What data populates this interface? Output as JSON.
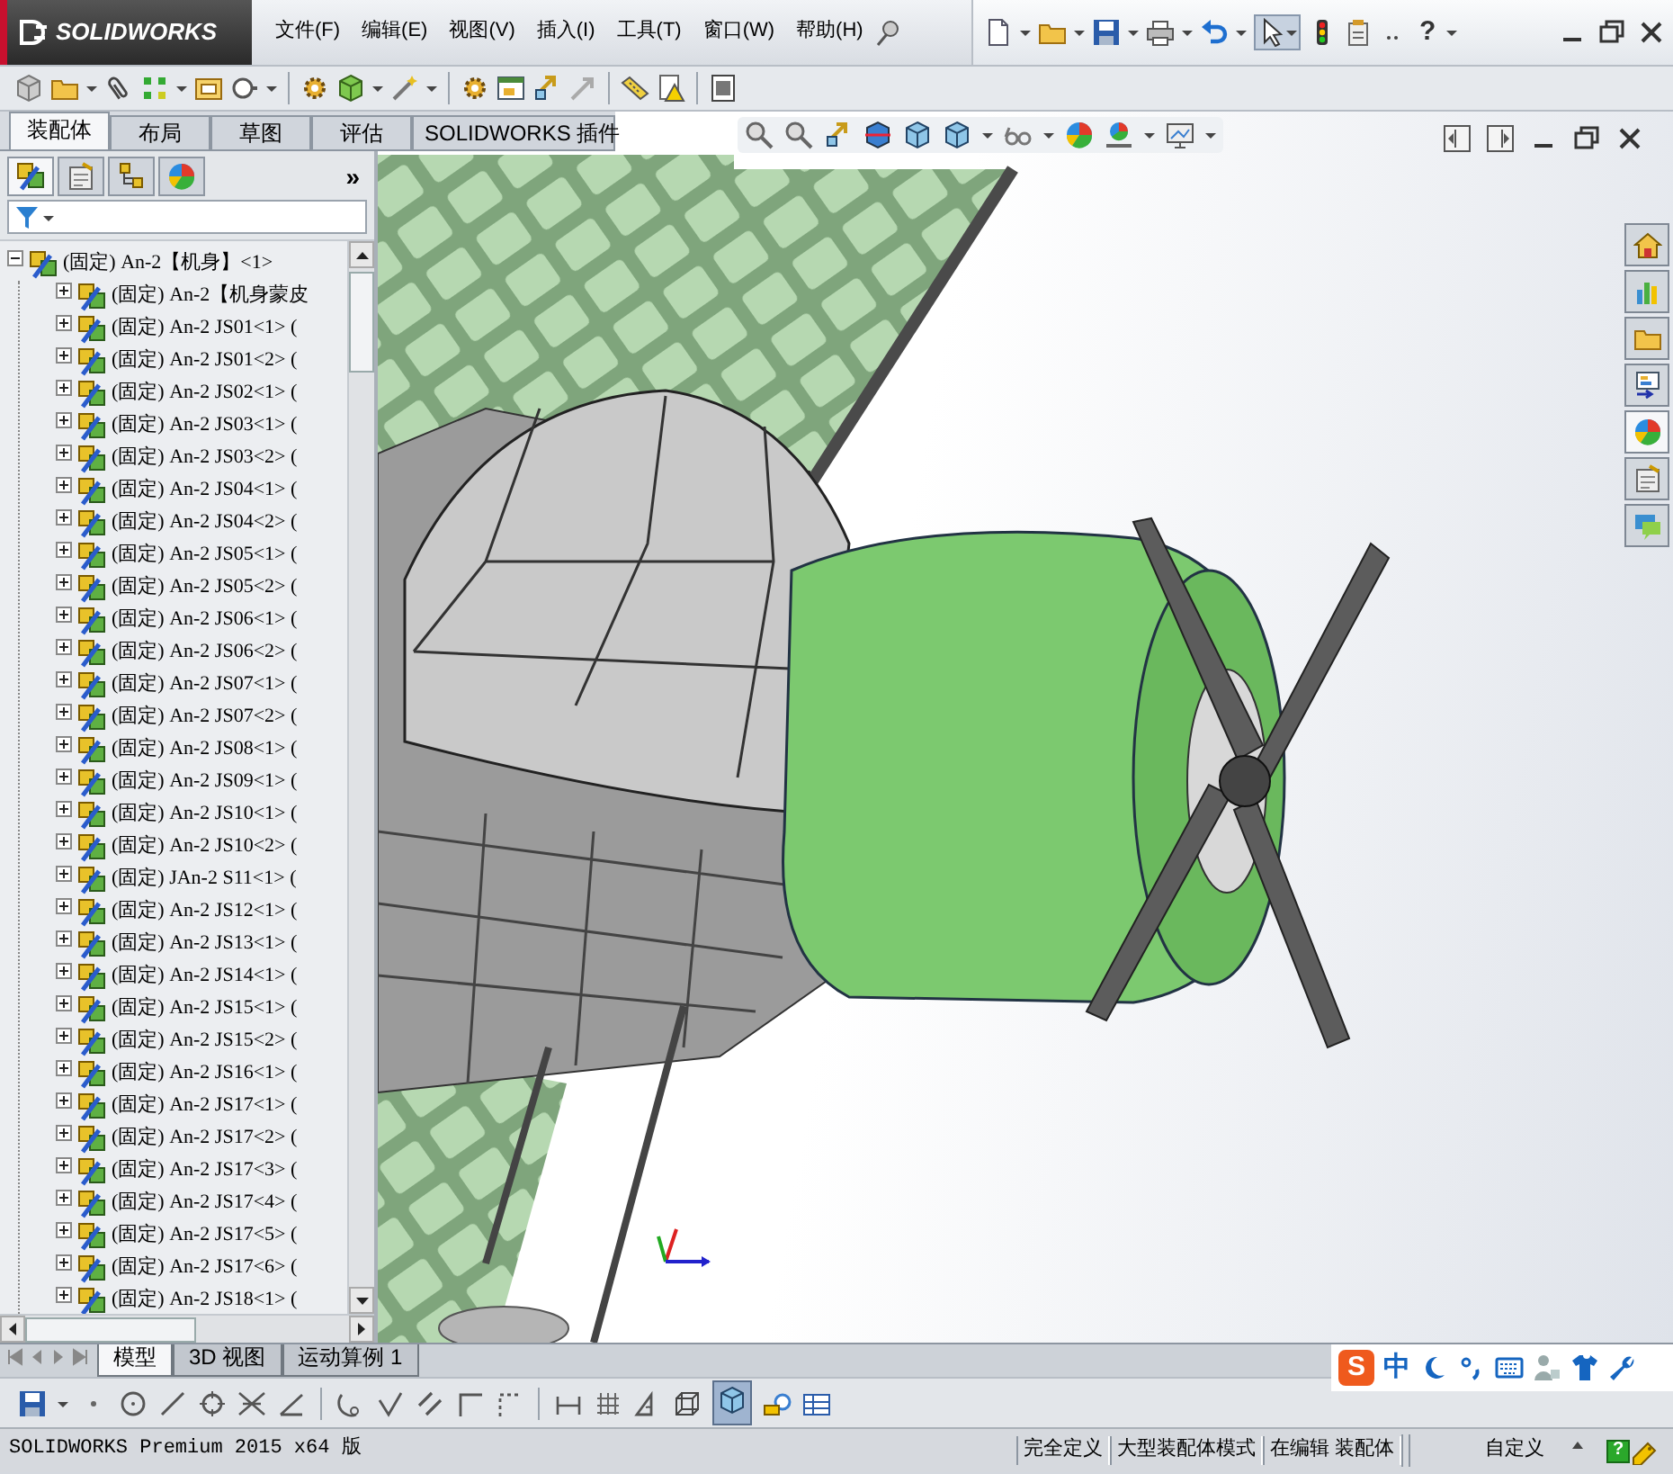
{
  "title_bar": {
    "logo": "SOLIDWORKS",
    "menus": [
      "文件(F)",
      "编辑(E)",
      "视图(V)",
      "插入(I)",
      "工具(T)",
      "窗口(W)",
      "帮助(H)"
    ],
    "help": "?"
  },
  "command_tabs": [
    {
      "label": "装配体",
      "selected": true
    },
    {
      "label": "布局",
      "selected": false
    },
    {
      "label": "草图",
      "selected": false
    },
    {
      "label": "评估",
      "selected": false
    },
    {
      "label": "SOLIDWORKS 插件",
      "selected": false
    }
  ],
  "panel_tabs": [
    {
      "kind": "feature",
      "selected": true
    },
    {
      "kind": "property",
      "selected": false
    },
    {
      "kind": "config",
      "selected": false
    },
    {
      "kind": "appearance",
      "selected": false
    }
  ],
  "panel_more": "»",
  "tree": {
    "label": "(固定) An-2【机身】<1>",
    "expanded": true,
    "children": [
      {
        "label": "(固定) An-2【机身蒙皮",
        "expanded": false
      },
      {
        "label": "(固定) An-2 JS01<1> (",
        "expanded": false
      },
      {
        "label": "(固定) An-2 JS01<2> (",
        "expanded": false
      },
      {
        "label": "(固定) An-2 JS02<1> (",
        "expanded": false
      },
      {
        "label": "(固定) An-2 JS03<1> (",
        "expanded": false
      },
      {
        "label": "(固定) An-2 JS03<2> (",
        "expanded": false
      },
      {
        "label": "(固定) An-2 JS04<1> (",
        "expanded": false
      },
      {
        "label": "(固定) An-2 JS04<2> (",
        "expanded": false
      },
      {
        "label": "(固定) An-2 JS05<1> (",
        "expanded": false
      },
      {
        "label": "(固定) An-2 JS05<2> (",
        "expanded": false
      },
      {
        "label": "(固定) An-2 JS06<1> (",
        "expanded": false
      },
      {
        "label": "(固定) An-2 JS06<2> (",
        "expanded": false
      },
      {
        "label": "(固定) An-2 JS07<1> (",
        "expanded": false
      },
      {
        "label": "(固定) An-2 JS07<2> (",
        "expanded": false
      },
      {
        "label": "(固定) An-2 JS08<1> (",
        "expanded": false
      },
      {
        "label": "(固定) An-2 JS09<1> (",
        "expanded": false
      },
      {
        "label": "(固定) An-2 JS10<1> (",
        "expanded": false
      },
      {
        "label": "(固定) An-2 JS10<2> (",
        "expanded": false
      },
      {
        "label": "(固定) JAn-2 S11<1> (",
        "expanded": false
      },
      {
        "label": "(固定) An-2 JS12<1> (",
        "expanded": false
      },
      {
        "label": "(固定) An-2 JS13<1> (",
        "expanded": false
      },
      {
        "label": "(固定) An-2 JS14<1> (",
        "expanded": false
      },
      {
        "label": "(固定) An-2 JS15<1> (",
        "expanded": false
      },
      {
        "label": "(固定) An-2 JS15<2> (",
        "expanded": false
      },
      {
        "label": "(固定) An-2 JS16<1> (",
        "expanded": false
      },
      {
        "label": "(固定) An-2 JS17<1> (",
        "expanded": false
      },
      {
        "label": "(固定) An-2 JS17<2> (",
        "expanded": false
      },
      {
        "label": "(固定) An-2 JS17<3> (",
        "expanded": false
      },
      {
        "label": "(固定) An-2 JS17<4> (",
        "expanded": false
      },
      {
        "label": "(固定) An-2 JS17<5> (",
        "expanded": false
      },
      {
        "label": "(固定) An-2 JS17<6> (",
        "expanded": false
      },
      {
        "label": "(固定) An-2 JS18<1> (",
        "expanded": false
      }
    ]
  },
  "bottom_tabs": [
    {
      "label": "模型",
      "selected": true
    },
    {
      "label": "3D 视图",
      "selected": false
    },
    {
      "label": "运动算例 1",
      "selected": false
    }
  ],
  "ime": {
    "logo": "S",
    "mode": "中"
  },
  "status_bar": {
    "product": "SOLIDWORKS Premium 2015 x64 版",
    "fields": [
      "完全定义",
      "大型装配体模式",
      "在编辑 装配体"
    ],
    "units": "自定义",
    "help": "?"
  }
}
